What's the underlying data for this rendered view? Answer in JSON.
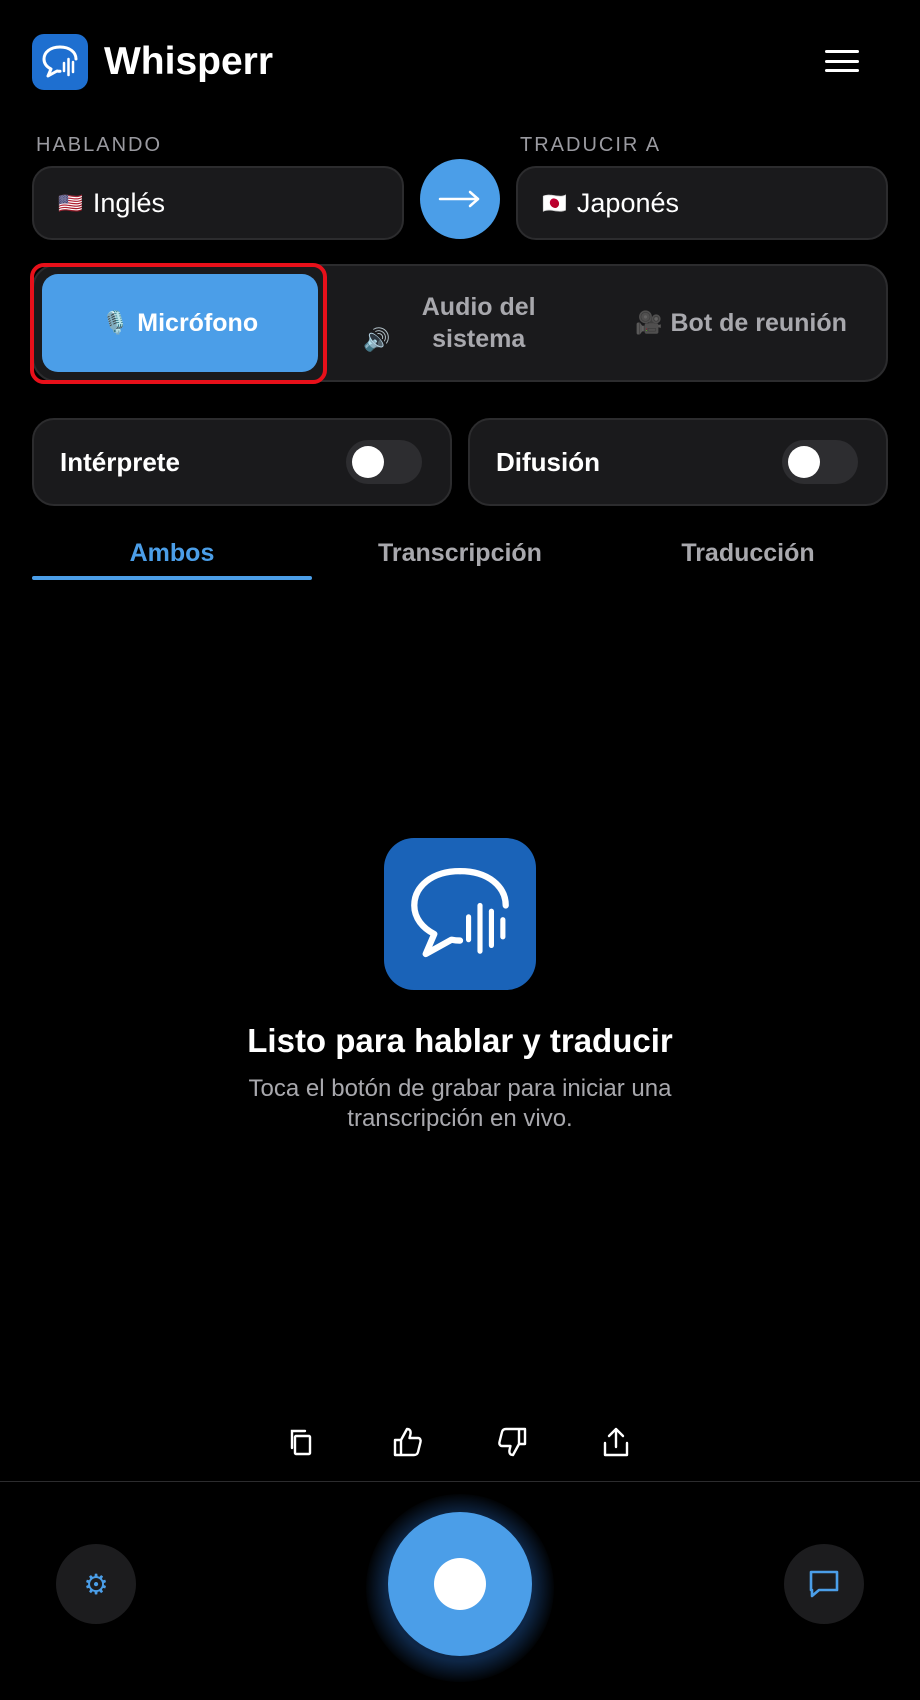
{
  "header": {
    "title": "Whisperr",
    "logo_icon": "speech-bubble-waveform-icon",
    "menu_icon": "hamburger-menu-icon"
  },
  "languages": {
    "source_label": "HABLANDO",
    "target_label": "TRADUCIR A",
    "source": {
      "flag": "🇺🇸",
      "name": "Inglés"
    },
    "target": {
      "flag": "🇯🇵",
      "name": "Japonés"
    },
    "swap_icon": "arrow-right-icon"
  },
  "input_modes": [
    {
      "icon": "🎙️",
      "label": "Micrófono",
      "active": true
    },
    {
      "icon": "🔊",
      "label": "Audio del sistema",
      "active": false
    },
    {
      "icon": "🎥",
      "label": "Bot de reunión",
      "active": false
    }
  ],
  "toggles": {
    "interpreter": {
      "label": "Intérprete",
      "on": false
    },
    "broadcast": {
      "label": "Difusión",
      "on": false
    }
  },
  "tabs": [
    {
      "label": "Ambos",
      "active": true
    },
    {
      "label": "Transcripción",
      "active": false
    },
    {
      "label": "Traducción",
      "active": false
    }
  ],
  "empty_state": {
    "title": "Listo para hablar y traducir",
    "subtitle": "Toca el botón de grabar para iniciar una transcripción en vivo."
  },
  "actions": [
    "copy-icon",
    "thumbs-up-icon",
    "thumbs-down-icon",
    "share-icon"
  ],
  "bottom_bar": {
    "settings_icon": "⚙",
    "chat_icon": "chat-bubble-icon",
    "record_icon": "record-icon"
  },
  "colors": {
    "accent": "#4b9ee8",
    "highlight": "#e8101a",
    "background": "#000000"
  }
}
